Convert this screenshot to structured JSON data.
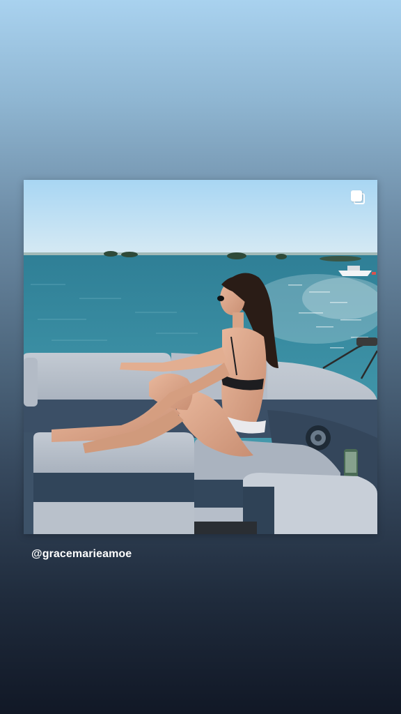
{
  "post": {
    "mention": "@gracemarieamoe",
    "media_type_icon": "carousel-multiple-icon"
  },
  "colors": {
    "sky": "#b8dcf2",
    "water": "#3f8fa3",
    "seat_light": "#b8c0cb",
    "seat_dark": "#3b4f66",
    "text": "#ffffff"
  }
}
